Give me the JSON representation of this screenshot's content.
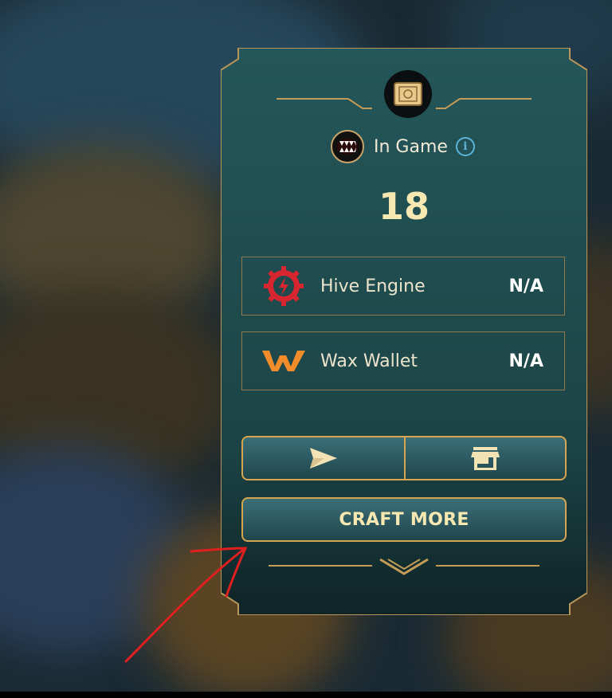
{
  "card": {
    "item_icon": "ticket-icon",
    "status": {
      "icon": "monster-mouth-icon",
      "label": "In Game",
      "info_icon": "info-icon",
      "info_glyph": "i"
    },
    "count": "18",
    "wallets": [
      {
        "icon": "hive-engine-icon",
        "name": "Hive Engine",
        "value": "N/A",
        "icon_color": "#d7262f"
      },
      {
        "icon": "wax-icon",
        "name": "Wax Wallet",
        "value": "N/A",
        "icon_color": "#f08c2a"
      }
    ],
    "actions": {
      "send_icon": "send-icon",
      "market_icon": "store-icon",
      "craft_label": "CRAFT MORE"
    }
  },
  "colors": {
    "panel": "#1f4a4d",
    "gold": "#d7a54f",
    "text_gold": "#f7e7b0"
  }
}
